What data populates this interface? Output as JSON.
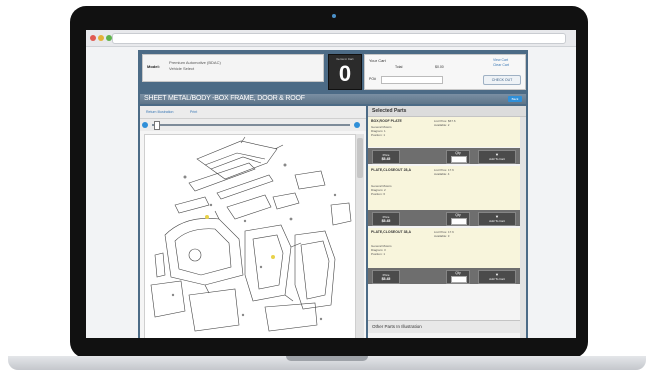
{
  "vehicle": {
    "label": "Model:",
    "line1": "Premium Automotive (BDAC)",
    "line2": "Vehicle Select"
  },
  "cart": {
    "caption": "Items in Cart",
    "count": "0",
    "title": "Your Cart",
    "total_label": "Total",
    "total_value": "$0.00",
    "po_label": "PO#",
    "po_value": "",
    "link_1": "View Cart",
    "link_2": "Clear Cart",
    "checkout_label": "CHECK OUT"
  },
  "section": {
    "title": "SHEET METAL/BODY -BOX FRAME, DOOR & ROOF",
    "button": "Back",
    "link_illustration": "Return Illustration",
    "link_print": "Print",
    "drawing_label": "Parts Illustration"
  },
  "selected_parts": {
    "title": "Selected Parts",
    "parts": [
      {
        "number": "BOX,ROOF PLATE",
        "list": "List Price: $67.6",
        "avail": "Available: 2",
        "desc": [
          "General Motors",
          "Diagram: 1",
          "Position: 1"
        ],
        "price_label": "Price",
        "price": "$5.45",
        "qty_label": "Qty",
        "add_label": "Add To Cart"
      },
      {
        "number": "PLATE,CLOSEOUT 28,A",
        "list": "List Price: 17.6",
        "avail": "Available: 4",
        "desc": [
          "General Motors",
          "Diagram: 2",
          "Position: 6"
        ],
        "price_label": "Price",
        "price": "$5.45",
        "qty_label": "Qty",
        "add_label": "Add To Cart"
      },
      {
        "number": "PLATE,CLOSEOUT 38,A",
        "list": "List Price: 17.6",
        "avail": "Available: 3",
        "desc": [
          "General Motors",
          "Diagram: 3",
          "Position: 1"
        ],
        "price_label": "Price",
        "price": "$5.45",
        "qty_label": "Qty",
        "add_label": "Add To Cart"
      }
    ],
    "other_parts": "Other Parts In Illustration"
  },
  "colors": {
    "accent": "#2f8fd8",
    "header": "#5e7589",
    "part_bg": "#f8f5dc"
  }
}
